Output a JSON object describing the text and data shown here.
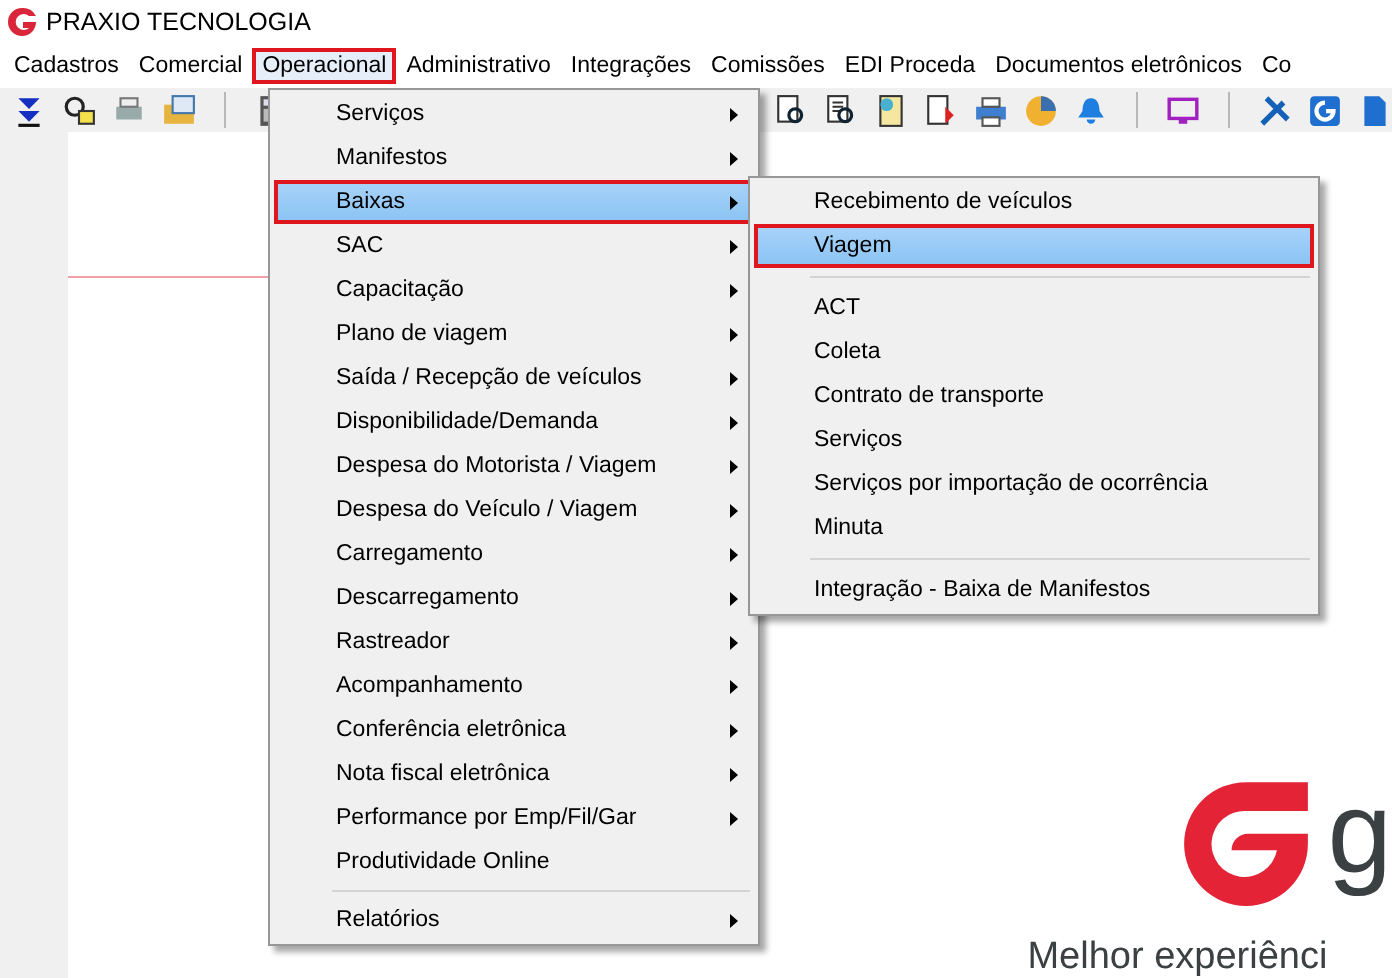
{
  "window": {
    "title": "PRAXIO TECNOLOGIA"
  },
  "menu_bar": [
    {
      "label": "Cadastros",
      "selected": false
    },
    {
      "label": "Comercial",
      "selected": false
    },
    {
      "label": "Operacional",
      "selected": true
    },
    {
      "label": "Administrativo",
      "selected": false
    },
    {
      "label": "Integrações",
      "selected": false
    },
    {
      "label": "Comissões",
      "selected": false
    },
    {
      "label": "EDI Proceda",
      "selected": false
    },
    {
      "label": "Documentos eletrônicos",
      "selected": false
    },
    {
      "label": "Co",
      "selected": false
    }
  ],
  "operacional_menu": [
    {
      "kind": "item",
      "label": "Serviços",
      "has_submenu": true,
      "selected": false
    },
    {
      "kind": "item",
      "label": "Manifestos",
      "has_submenu": true,
      "selected": false
    },
    {
      "kind": "item",
      "label": "Baixas",
      "has_submenu": true,
      "selected": true
    },
    {
      "kind": "item",
      "label": "SAC",
      "has_submenu": true,
      "selected": false
    },
    {
      "kind": "item",
      "label": "Capacitação",
      "has_submenu": true,
      "selected": false
    },
    {
      "kind": "item",
      "label": "Plano de viagem",
      "has_submenu": true,
      "selected": false
    },
    {
      "kind": "item",
      "label": "Saída / Recepção de veículos",
      "has_submenu": true,
      "selected": false
    },
    {
      "kind": "item",
      "label": "Disponibilidade/Demanda",
      "has_submenu": true,
      "selected": false
    },
    {
      "kind": "item",
      "label": "Despesa do Motorista / Viagem",
      "has_submenu": true,
      "selected": false
    },
    {
      "kind": "item",
      "label": "Despesa do Veículo / Viagem",
      "has_submenu": true,
      "selected": false
    },
    {
      "kind": "item",
      "label": "Carregamento",
      "has_submenu": true,
      "selected": false
    },
    {
      "kind": "item",
      "label": "Descarregamento",
      "has_submenu": true,
      "selected": false
    },
    {
      "kind": "item",
      "label": "Rastreador",
      "has_submenu": true,
      "selected": false
    },
    {
      "kind": "item",
      "label": "Acompanhamento",
      "has_submenu": true,
      "selected": false
    },
    {
      "kind": "item",
      "label": "Conferência eletrônica",
      "has_submenu": true,
      "selected": false
    },
    {
      "kind": "item",
      "label": "Nota fiscal eletrônica",
      "has_submenu": true,
      "selected": false
    },
    {
      "kind": "item",
      "label": "Performance por Emp/Fil/Gar",
      "has_submenu": true,
      "selected": false
    },
    {
      "kind": "item",
      "label": "Produtividade Online",
      "has_submenu": false,
      "selected": false
    },
    {
      "kind": "separator"
    },
    {
      "kind": "item",
      "label": "Relatórios",
      "has_submenu": true,
      "selected": false
    }
  ],
  "baixas_submenu": [
    {
      "kind": "item",
      "label": "Recebimento de veículos",
      "selected": false
    },
    {
      "kind": "item",
      "label": "Viagem",
      "selected": true
    },
    {
      "kind": "separator"
    },
    {
      "kind": "item",
      "label": "ACT",
      "selected": false
    },
    {
      "kind": "item",
      "label": "Coleta",
      "selected": false
    },
    {
      "kind": "item",
      "label": "Contrato de transporte",
      "selected": false
    },
    {
      "kind": "item",
      "label": "Serviços",
      "selected": false
    },
    {
      "kind": "item",
      "label": "Serviços por importação de ocorrência",
      "selected": false
    },
    {
      "kind": "item",
      "label": "Minuta",
      "selected": false
    },
    {
      "kind": "separator"
    },
    {
      "kind": "item",
      "label": "Integração - Baixa de Manifestos",
      "selected": false
    }
  ],
  "splash": {
    "logo_text": "g",
    "tagline": "Melhor experiênci"
  }
}
